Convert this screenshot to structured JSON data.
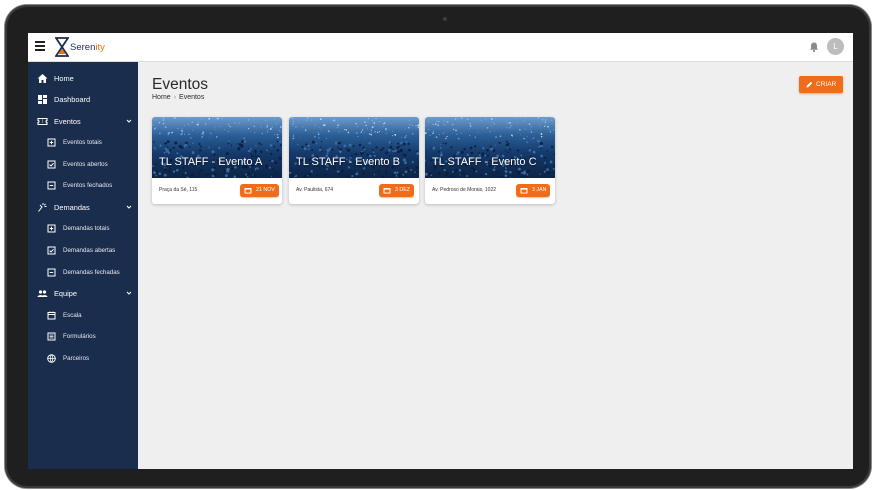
{
  "app": {
    "brand_prefix": "Seren",
    "brand_suffix": "ity",
    "avatar_initial": "L",
    "accent_color": "#ef6c1a",
    "sidebar_color": "#1b2d4c"
  },
  "sidebar": {
    "items": [
      {
        "label": "Home",
        "icon": "home-icon"
      },
      {
        "label": "Dashboard",
        "icon": "dashboard-icon"
      },
      {
        "label": "Eventos",
        "icon": "ticket-icon",
        "expandable": true
      },
      {
        "label": "Eventos totais",
        "icon": "plus-box-icon"
      },
      {
        "label": "Eventos abertos",
        "icon": "check-box-icon"
      },
      {
        "label": "Eventos fechados",
        "icon": "minus-box-icon"
      },
      {
        "label": "Demandas",
        "icon": "tasks-icon",
        "expandable": true
      },
      {
        "label": "Demandas totais",
        "icon": "plus-box-icon"
      },
      {
        "label": "Demandas abertas",
        "icon": "check-box-icon"
      },
      {
        "label": "Demandas fechadas",
        "icon": "minus-box-icon"
      },
      {
        "label": "Equipe",
        "icon": "group-icon",
        "expandable": true
      },
      {
        "label": "Escala",
        "icon": "calendar-icon"
      },
      {
        "label": "Formulários",
        "icon": "list-icon"
      },
      {
        "label": "Parceiros",
        "icon": "globe-icon"
      }
    ]
  },
  "page": {
    "title": "Eventos",
    "breadcrumb": [
      "Home",
      "Eventos"
    ],
    "create_button": "CRIAR"
  },
  "events": [
    {
      "title": "TL STAFF - Evento A",
      "address": "Praça da Sé, 115",
      "date": "21 NOV"
    },
    {
      "title": "TL STAFF - Evento B",
      "address": "Av. Paulista, 674",
      "date": "3 DEZ"
    },
    {
      "title": "TL STAFF - Evento C",
      "address": "Av. Pedroso de Morais, 1022",
      "date": "3 JAN"
    }
  ]
}
